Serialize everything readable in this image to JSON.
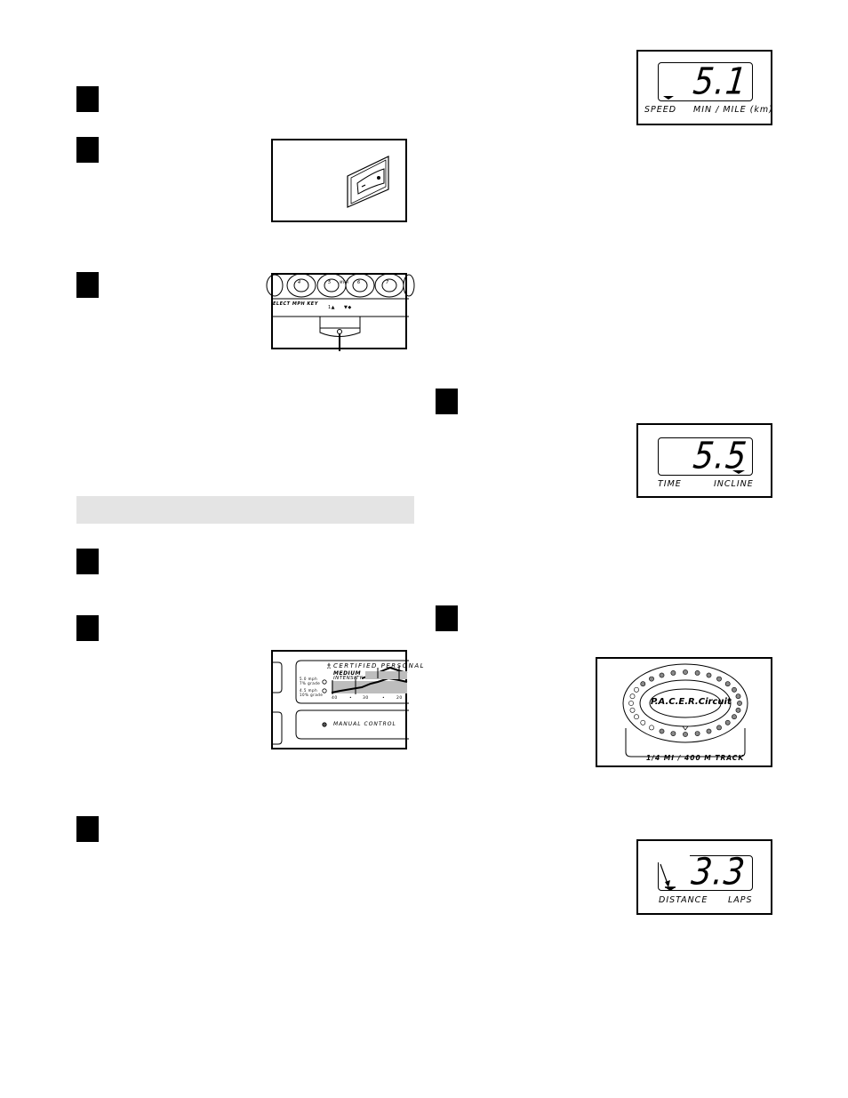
{
  "left_column": {
    "step_markers": [
      "step-1",
      "step-2",
      "step-3",
      "step-4",
      "step-5",
      "step-6"
    ],
    "section_bar": {
      "label": ""
    },
    "power_switch_figure": {
      "icon": "power-switch-icon"
    },
    "speed_keys_figure": {
      "keys": [
        "4",
        "5",
        "6",
        "7"
      ],
      "mph_label": "MPH",
      "select_label": "ELECT MPH KEY",
      "arrow_up_label": "1▲",
      "arrow_down_label": "▼◆"
    },
    "program_panel_figure": {
      "title": "CERTIFIED PERSONAL",
      "intensity_level": "MEDIUM",
      "intensity_label": "INTENSITY",
      "options": [
        {
          "line1": "5.0 mph",
          "line2": "7% grade"
        },
        {
          "line1": "4.5 mph",
          "line2": "10% grade"
        }
      ],
      "x_ticks": [
        "40",
        "•",
        "30",
        "•",
        "20"
      ],
      "manual_label": "MANUAL CONTROL"
    }
  },
  "right_column": {
    "step_markers": [
      "step-a",
      "step-b"
    ],
    "speed_display": {
      "value": "5.1",
      "left_label": "SPEED",
      "right_label": "MIN / MILE (km)",
      "indicator": "left"
    },
    "incline_display": {
      "value": "5.5",
      "left_label": "TIME",
      "right_label": "INCLINE",
      "indicator": "right"
    },
    "track_display": {
      "logo": "P.A.C.E.R.Circuit",
      "caption": "1/4 MI / 400 M TRACK"
    },
    "distance_display": {
      "value": "3.3",
      "left_label": "DISTANCE",
      "right_label": "LAPS",
      "indicator": "left"
    }
  }
}
